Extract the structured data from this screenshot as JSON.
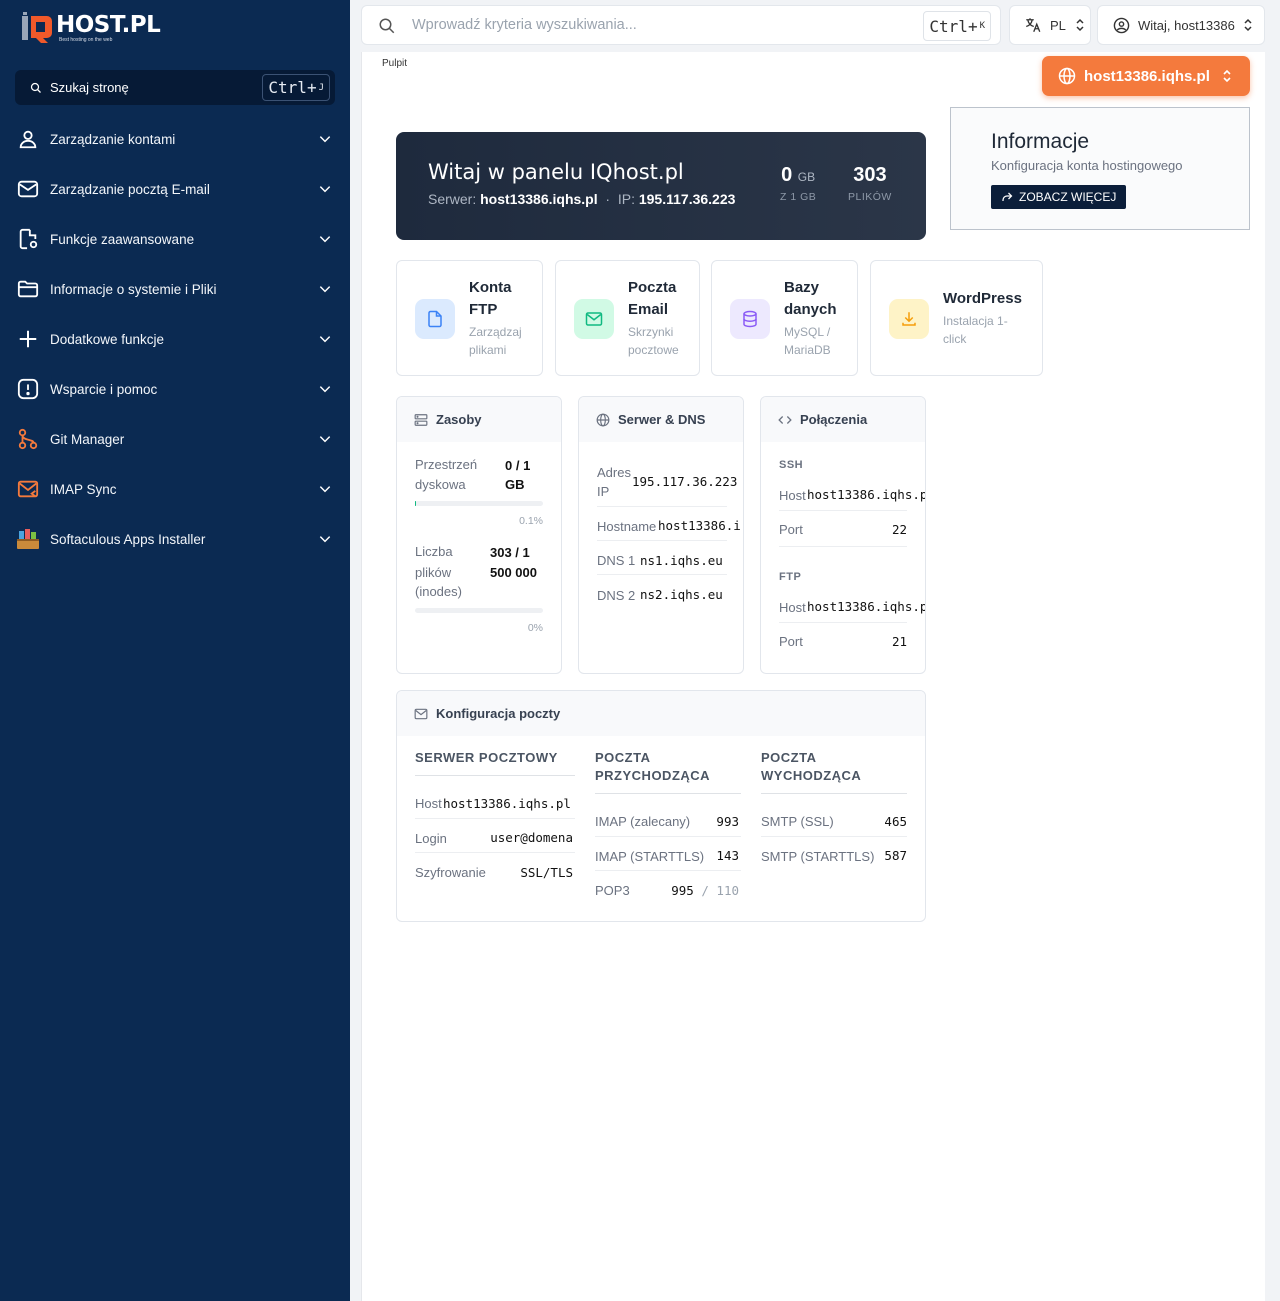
{
  "brand": {
    "name": "HOST.PL",
    "tagline": "Best hosting on the web",
    "accent": "#f47a3d",
    "sidebar_bg": "#0b2a52"
  },
  "sidebar": {
    "search_label": "Szukaj stronę",
    "search_shortcut": "Ctrl+",
    "search_shortcut_key": "J",
    "items": [
      {
        "label": "Zarządzanie kontami",
        "icon": "user-icon"
      },
      {
        "label": "Zarządzanie pocztą E-mail",
        "icon": "mail-icon"
      },
      {
        "label": "Funkcje zaawansowane",
        "icon": "file-settings-icon"
      },
      {
        "label": "Informacje o systemie i Pliki",
        "icon": "folder-icon"
      },
      {
        "label": "Dodatkowe funkcje",
        "icon": "plus-icon"
      },
      {
        "label": "Wsparcie i pomoc",
        "icon": "alert-icon"
      },
      {
        "label": "Git Manager",
        "icon": "git-icon"
      },
      {
        "label": "IMAP Sync",
        "icon": "imap-sync-icon"
      },
      {
        "label": "Softaculous Apps Installer",
        "icon": "softaculous-icon"
      }
    ]
  },
  "topbar": {
    "search_placeholder": "Wprowadź kryteria wyszukiwania...",
    "shortcut": "Ctrl+",
    "shortcut_key": "K",
    "language": "PL",
    "user_greeting": "Witaj, host13386"
  },
  "breadcrumb": "Pulpit",
  "domain_selector": "host13386.iqhs.pl",
  "hero": {
    "title": "Witaj w panelu IQhost.pl",
    "server_label": "Serwer:",
    "server": "host13386.iqhs.pl",
    "dot": "·",
    "ip_label": "IP:",
    "ip": "195.117.36.223",
    "disk_value": "0",
    "disk_unit": "GB",
    "disk_caption": "Z 1 GB",
    "files_value": "303",
    "files_caption": "PLIKÓW"
  },
  "info": {
    "title": "Informacje",
    "subtitle": "Konfiguracja konta hostingowego",
    "button": "ZOBACZ WIĘCEJ"
  },
  "quick": [
    {
      "title1": "Konta",
      "title2": "FTP",
      "desc1": "Zarządzaj",
      "desc2": "plikami",
      "color": "#3b82f6",
      "bg": "#dbeafe"
    },
    {
      "title1": "Poczta",
      "title2": "Email",
      "desc1": "Skrzynki",
      "desc2": "pocztowe",
      "color": "#10b981",
      "bg": "#d1fae5"
    },
    {
      "title1": "Bazy",
      "title2": "danych",
      "desc1": "MySQL /",
      "desc2": "MariaDB",
      "color": "#8b5cf6",
      "bg": "#ede9fe"
    },
    {
      "title1": "WordPress",
      "title2": "",
      "desc1": "Instalacja 1-",
      "desc2": "click",
      "color": "#f59e0b",
      "bg": "#fef3c7"
    }
  ],
  "resources": {
    "title": "Zasoby",
    "disk_label1": "Przestrzeń",
    "disk_label2": "dyskowa",
    "disk_value1": "0 / 1",
    "disk_value2": "GB",
    "disk_percent": "0.1%",
    "disk_fraction": 0.001,
    "inodes_label1": "Liczba",
    "inodes_label2": "plików",
    "inodes_label3": "(inodes)",
    "inodes_value1": "303 / 1",
    "inodes_value2": "500 000",
    "inodes_percent": "0%"
  },
  "dns": {
    "title": "Serwer & DNS",
    "ip_label1": "Adres",
    "ip_label2": "IP",
    "ip": "195.117.36.223",
    "hostname_label": "Hostname",
    "hostname": "host13386.i",
    "dns1_label": "DNS 1",
    "dns1": "ns1.iqhs.eu",
    "dns2_label": "DNS 2",
    "dns2": "ns2.iqhs.eu"
  },
  "connections": {
    "title": "Połączenia",
    "ssh_title": "SSH",
    "ssh_host_label": "Host",
    "ssh_host": "host13386.iqhs.p",
    "ssh_port_label": "Port",
    "ssh_port": "22",
    "ftp_title": "FTP",
    "ftp_host_label": "Host",
    "ftp_host": "host13386.iqhs.p",
    "ftp_port_label": "Port",
    "ftp_port": "21"
  },
  "mail": {
    "title": "Konfiguracja poczty",
    "col1": "SERWER POCZTOWY",
    "col2a": "POCZTA",
    "col2b": "PRZYCHODZĄCA",
    "col3a": "POCZTA",
    "col3b": "WYCHODZĄCA",
    "host_label": "Host",
    "host": "host13386.iqhs.pl",
    "login_label": "Login",
    "login": "user@domena",
    "enc_label": "Szyfrowanie",
    "enc": "SSL/TLS",
    "imap_label": "IMAP (zalecany)",
    "imap_port": "993",
    "imap_starttls_label": "IMAP (STARTTLS)",
    "imap_starttls_port": "143",
    "pop3_label": "POP3",
    "pop3_port": "995",
    "pop3_sep": "/",
    "pop3_alt": "110",
    "smtp_label": "SMTP (SSL)",
    "smtp_port": "465",
    "smtp_starttls_label": "SMTP (STARTTLS)",
    "smtp_starttls_port": "587"
  }
}
